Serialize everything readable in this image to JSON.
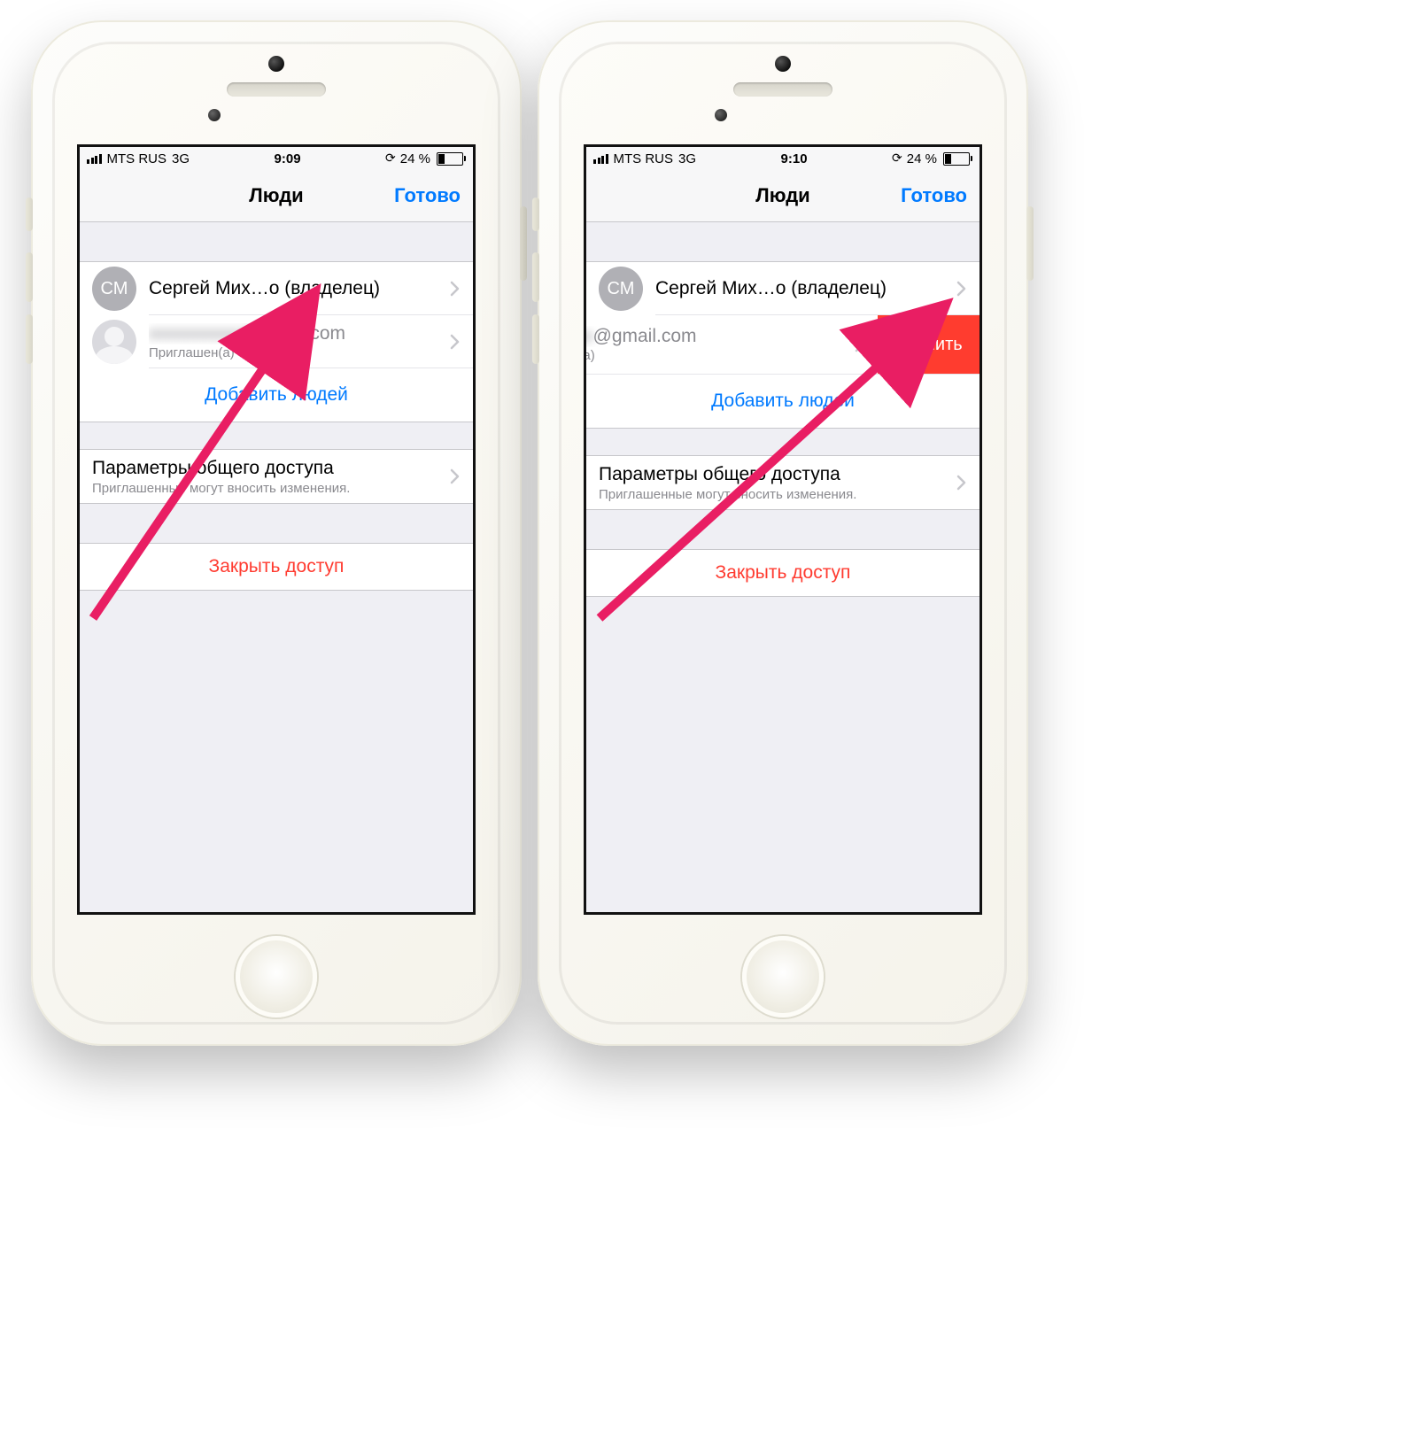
{
  "colors": {
    "accent": "#007aff",
    "danger": "#ff3b30",
    "swipe": "#ff3c2f",
    "arrow": "#e91e63"
  },
  "screens": [
    {
      "id": "left",
      "status": {
        "carrier": "MTS RUS",
        "network": "3G",
        "time": "9:09",
        "battery_pct": "24 %"
      },
      "nav": {
        "title": "Люди",
        "done": "Готово"
      },
      "people": {
        "owner": {
          "initials": "СМ",
          "name": "Сергей Мих…о (владелец)"
        },
        "invited": {
          "email_prefix_hidden": "",
          "email_suffix": "gmail.com",
          "status": "Приглашен(а)"
        },
        "add": "Добавить людей"
      },
      "settings": {
        "title": "Параметры общего доступа",
        "sub": "Приглашенные могут вносить изменения."
      },
      "revoke": "Закрыть доступ"
    },
    {
      "id": "right",
      "status": {
        "carrier": "MTS RUS",
        "network": "3G",
        "time": "9:10",
        "battery_pct": "24 %"
      },
      "nav": {
        "title": "Люди",
        "done": "Готово"
      },
      "people": {
        "owner": {
          "initials": "СМ",
          "name": "Сергей Мих…о (владелец)"
        },
        "invited": {
          "email_prefix_hidden": "",
          "email_suffix": "@gmail.com",
          "status": "Приглашен(а)"
        },
        "add": "Добавить людей"
      },
      "swipe_delete": "Удалить",
      "settings": {
        "title": "Параметры общего доступа",
        "sub": "Приглашенные могут вносить изменения."
      },
      "revoke": "Закрыть доступ"
    }
  ]
}
